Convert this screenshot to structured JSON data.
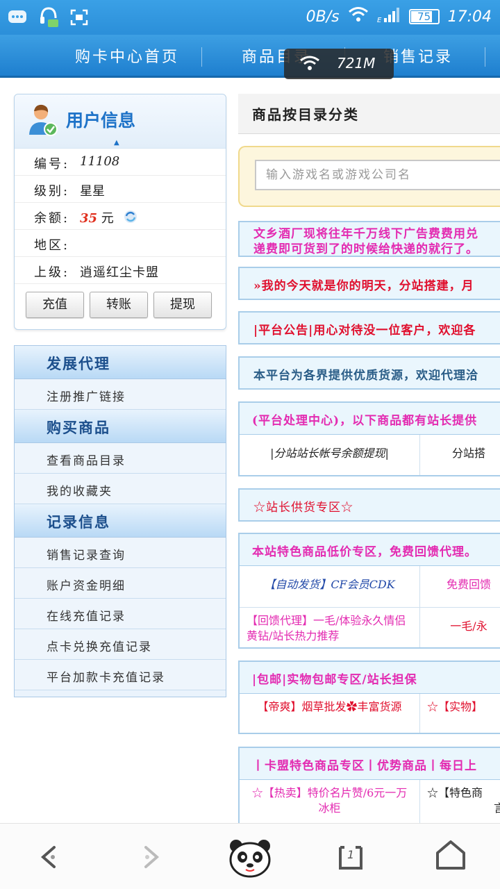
{
  "status_bar": {
    "speed": "0B/s",
    "battery": "75",
    "battery_level": 0.75,
    "time": "17:04"
  },
  "nav": {
    "items": [
      "购卡中心首页",
      "商品目录",
      "销售记录"
    ]
  },
  "toast": {
    "text": "721M"
  },
  "user_info": {
    "title": "用户信息",
    "rows": [
      {
        "label": "编号:",
        "value": "11108"
      },
      {
        "label": "级别:",
        "value": "星星"
      },
      {
        "label": "余额:",
        "value": "35",
        "unit": "元"
      },
      {
        "label": "地区:",
        "value": ""
      },
      {
        "label": "上级:",
        "value": "逍遥红尘卡盟"
      }
    ],
    "buttons": [
      "充值",
      "转账",
      "提现"
    ]
  },
  "menu": {
    "sections": [
      {
        "title": "发展代理",
        "items": [
          "注册推广链接"
        ]
      },
      {
        "title": "购买商品",
        "items": [
          "查看商品目录",
          "我的收藏夹"
        ]
      },
      {
        "title": "记录信息",
        "items": [
          "销售记录查询",
          "账户资金明细",
          "在线充值记录",
          "点卡兑换充值记录",
          "平台加款卡充值记录"
        ]
      }
    ]
  },
  "content": {
    "category_title": "商品按目录分类",
    "search_placeholder": "输入游戏名或游戏公司名",
    "notice1_line1": "文乡酒厂现将往年千万线下广告费费用兑",
    "notice1_line2": "递费即可货到了的时候给快递的就行了。",
    "notice2": "»我的今天就是你的明天，分站搭建，月",
    "notice3": "|平台公告|用心对待没一位客户，欢迎各",
    "notice4": "本平台为各界提供优质货源，欢迎代理洽",
    "table1": {
      "head": "(平台处理中心)，以下商品都有站长提供",
      "c1": "|分站站长帐号余额提现|",
      "c2": "分站搭"
    },
    "notice5": "☆站长供货专区☆",
    "table2": {
      "head": "本站特色商品低价专区，免费回馈代理。",
      "rows": [
        {
          "c1": "【自动发货】CF会员CDK",
          "c2": "免费回馈"
        },
        {
          "c1": "【回馈代理】一毛/体验永久情侣黄钻/站长热力推荐",
          "c2": "一毛/永"
        }
      ]
    },
    "table3": {
      "head": "|包邮|实物包邮专区/站长担保",
      "c1": "【帝爽】烟草批发✿丰富货源",
      "c2": "☆【实物】",
      "c2b": "（"
    },
    "table4": {
      "head": "丨卡盟特色商品专区丨优势商品丨每日上",
      "c1": "☆【热卖】特价名片赞/6元一万 冰柜",
      "c2": "☆【特色商",
      "c2b": "言"
    }
  }
}
